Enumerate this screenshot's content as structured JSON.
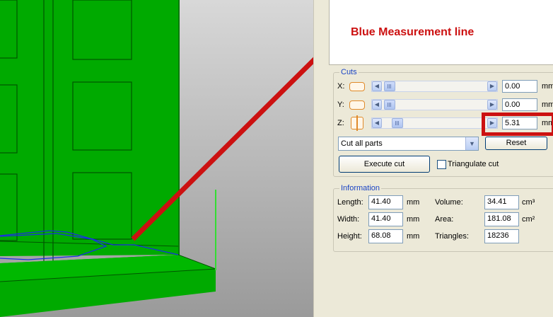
{
  "annotation": {
    "text": "Blue Measurement line"
  },
  "cuts": {
    "title": "Cuts",
    "axes": [
      {
        "label": "X:",
        "value": "0.00",
        "unit": "mm"
      },
      {
        "label": "Y:",
        "value": "0.00",
        "unit": "mm"
      },
      {
        "label": "Z:",
        "value": "5.31",
        "unit": "mm"
      }
    ],
    "mode_select": "Cut all parts",
    "reset_label": "Reset",
    "execute_label": "Execute cut",
    "triangulate_label": "Triangulate cut"
  },
  "information": {
    "title": "Information",
    "length": {
      "label": "Length:",
      "value": "41.40",
      "unit": "mm"
    },
    "width": {
      "label": "Width:",
      "value": "41.40",
      "unit": "mm"
    },
    "height": {
      "label": "Height:",
      "value": "68.08",
      "unit": "mm"
    },
    "volume": {
      "label": "Volume:",
      "value": "34.41",
      "unit": "cm³"
    },
    "area": {
      "label": "Area:",
      "value": "181.08",
      "unit": "cm²"
    },
    "triangles": {
      "label": "Triangles:",
      "value": "18236"
    }
  },
  "colors": {
    "model": "#00aa00",
    "annotation": "#cc1111",
    "measure_line": "#1a2ee6",
    "axis_line": "#33dd33"
  }
}
